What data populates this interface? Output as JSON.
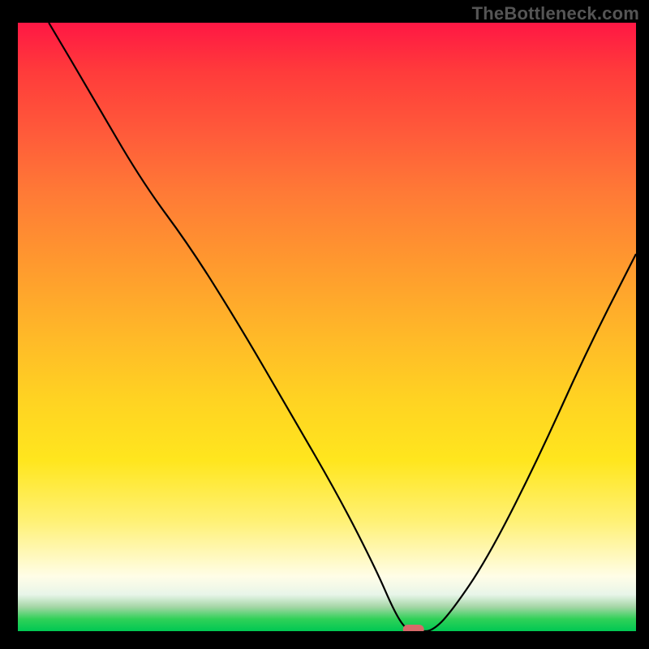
{
  "watermark": "TheBottleneck.com",
  "chart_data": {
    "type": "line",
    "title": "",
    "xlabel": "",
    "ylabel": "",
    "xlim": [
      0,
      100
    ],
    "ylim": [
      0,
      100
    ],
    "grid": false,
    "legend": false,
    "series": [
      {
        "name": "bottleneck-curve",
        "x": [
          5,
          12,
          20,
          28,
          36,
          44,
          52,
          58,
          61,
          63,
          65,
          67,
          70,
          76,
          84,
          92,
          100
        ],
        "y": [
          100,
          88,
          74,
          63,
          50,
          36,
          22,
          10,
          3,
          0,
          0,
          0,
          3,
          12,
          28,
          46,
          62
        ]
      }
    ],
    "marker": {
      "name": "optimal-point",
      "x": 64,
      "y": 0
    },
    "background_gradient": {
      "stops": [
        {
          "pos": 0,
          "color": "#ff1744"
        },
        {
          "pos": 50,
          "color": "#ffba28"
        },
        {
          "pos": 80,
          "color": "#fff176"
        },
        {
          "pos": 95,
          "color": "#a5d6a7"
        },
        {
          "pos": 100,
          "color": "#00c853"
        }
      ]
    }
  }
}
